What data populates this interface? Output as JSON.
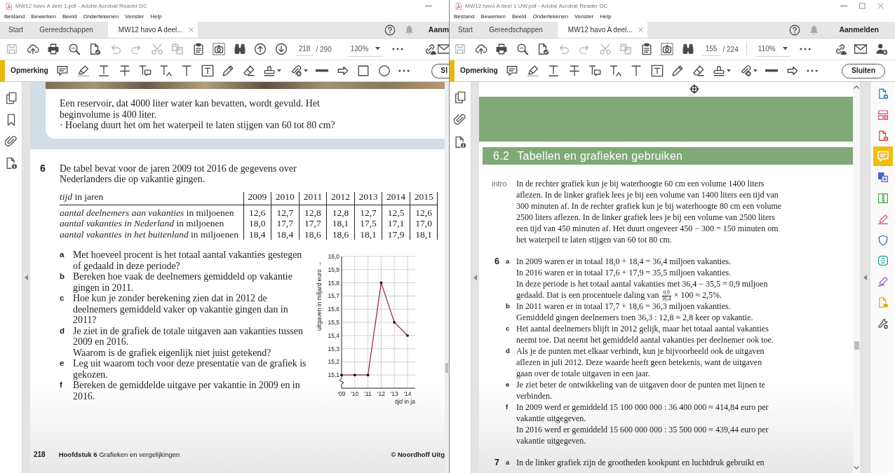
{
  "windows": [
    {
      "title": "MW12 havo A deel 1.pdf - Adobe Acrobat Reader DC",
      "window_buttons": [
        {
          "kind": "minimize"
        }
      ],
      "menu": [
        "Bestand",
        "Bewerken",
        "Beeld",
        "Ondertekenen",
        "Venster",
        "Help"
      ],
      "tabs": [
        {
          "label": "Start",
          "selected": false,
          "closable": false
        },
        {
          "label": "Gereedschappen",
          "selected": false,
          "closable": false
        },
        {
          "label": "MW12 havo A deel...",
          "selected": true,
          "closable": true
        }
      ],
      "account": "Aanm",
      "toolbar": {
        "tools": [
          {
            "kind": "save",
            "disabled": true
          },
          {
            "kind": "upload",
            "disabled": false
          },
          {
            "kind": "print",
            "disabled": false
          },
          {
            "kind": "zoom-search",
            "disabled": false
          },
          {
            "kind": "file-check",
            "disabled": false
          },
          {
            "kind": "undo",
            "disabled": true
          },
          {
            "kind": "redo",
            "disabled": true
          },
          {
            "kind": "cut",
            "disabled": true
          },
          {
            "kind": "copy",
            "disabled": true
          },
          {
            "kind": "clipboard",
            "disabled": false
          },
          {
            "kind": "snapshot",
            "disabled": false
          },
          {
            "kind": "find",
            "disabled": false
          },
          {
            "kind": "previous-page",
            "disabled": false
          },
          {
            "kind": "next-page",
            "disabled": false
          }
        ],
        "page": "218",
        "page_total": "/ 290",
        "zoom": "130%",
        "tools_end": [
          {
            "kind": "more"
          },
          {
            "kind": "share-link"
          },
          {
            "kind": "mail"
          }
        ]
      },
      "comment_bar": {
        "title": "Opmerking",
        "tools": [
          {
            "kind": "sticky-note"
          },
          {
            "kind": "highlight"
          },
          {
            "kind": "underline"
          },
          {
            "kind": "strikethrough"
          },
          {
            "kind": "replace-text"
          },
          {
            "kind": "insert-text"
          },
          {
            "kind": "add-text"
          },
          {
            "kind": "text-box"
          },
          {
            "kind": "pencil"
          },
          {
            "kind": "eraser"
          },
          {
            "kind": "stamp"
          },
          {
            "kind": "attach"
          },
          {
            "kind": "line"
          },
          {
            "kind": "arrow"
          },
          {
            "kind": "rectangle"
          },
          {
            "kind": "oval"
          },
          {
            "kind": "more"
          }
        ],
        "close_button": "Sl"
      },
      "sidebar": [
        {
          "kind": "pages"
        },
        {
          "kind": "bookmarks"
        },
        {
          "kind": "attachments"
        },
        {
          "kind": "properties"
        }
      ],
      "document": {
        "blocks": [
          {
            "kind": "exercise-box",
            "photo": true,
            "paragraphs": [
              [
                "Een reservoir, dat 4000 liter water kan bevatten, wordt gevuld. Het",
                "beginvolume is 400 liter."
              ],
              [
                "· Hoelang duurt het om het waterpeil te laten stijgen van 60 tot 80 cm?"
              ]
            ]
          },
          {
            "kind": "question",
            "number": "6",
            "lines": [
              "De tabel bevat voor de jaren 2009 tot 2016 de gegevens over",
              "Nederlanders die op vakantie gingen."
            ]
          },
          {
            "kind": "table",
            "columns": [
              "*tijd* in jaren",
              "2009",
              "2010",
              "2011",
              "2012",
              "2013",
              "2014",
              "2015"
            ],
            "rows": [
              [
                "*aantal deelnemers aan vakanties* in miljoenen",
                "12,6",
                "12,7",
                "12,8",
                "12,8",
                "12,7",
                "12,5",
                "12,6"
              ],
              [
                "*aantal vakanties in Nederland* in miljoenen",
                "18,0",
                "17,7",
                "17,7",
                "18,1",
                "17,5",
                "17,1",
                "17,0"
              ],
              [
                "*aantal vakanties in het buitenland* in miljoenen",
                "18,4",
                "18,4",
                "18,6",
                "18,6",
                "18,1",
                "17,9",
                "18,1"
              ]
            ]
          },
          {
            "kind": "questions-with-chart",
            "questions": [
              {
                "letter": "a",
                "lines": [
                  "Met hoeveel procent is het totaal aantal vakanties gestegen",
                  "of gedaald in deze periode?"
                ]
              },
              {
                "letter": "b",
                "lines": [
                  "Bereken hoe vaak de deelnemers gemiddeld op vakantie",
                  "gingen in 2011."
                ]
              },
              {
                "letter": "c",
                "lines": [
                  "Hoe kun je zonder berekening zien dat in 2012 de",
                  "deelnemers gemiddeld vaker op vakantie gingen dan in",
                  "2011?"
                ]
              },
              {
                "letter": "d",
                "lines": [
                  "Je ziet in de grafiek de totale uitgaven aan vakanties tussen",
                  "2009 en 2016.",
                  "Waarom is de grafiek eigenlijk niet juist getekend?"
                ]
              },
              {
                "letter": "e",
                "lines": [
                  "Leg uit waarom toch voor deze presentatie van de grafiek is",
                  "gekozen."
                ]
              },
              {
                "letter": "f",
                "lines": [
                  "Bereken de gemiddelde uitgave per vakantie in 2009 en in",
                  "2016."
                ]
              }
            ],
            "chart_data": {
              "type": "line",
              "grid": true,
              "xlabel": "*tijd* in ja",
              "ylabel": "uitgaven in miljard euro →",
              "categories": [
                "'09",
                "'10",
                "'11",
                "'12",
                "'13",
                "'14"
              ],
              "values": [
                15.1,
                15.1,
                15.1,
                15.8,
                15.5,
                15.4
              ],
              "ylim": [
                15.0,
                16.0
              ],
              "yticks": [
                {
                  "value": 15.1,
                  "label": "15,1"
                },
                {
                  "value": 15.2,
                  "label": "15,2"
                },
                {
                  "value": 15.3,
                  "label": "15,3"
                },
                {
                  "value": 15.4,
                  "label": "15,4"
                },
                {
                  "value": 15.5,
                  "label": "15,5"
                },
                {
                  "value": 15.6,
                  "label": "15,6"
                },
                {
                  "value": 15.7,
                  "label": "15,7"
                },
                {
                  "value": 15.8,
                  "label": "15,8"
                },
                {
                  "value": 15.9,
                  "label": "15,9"
                },
                {
                  "value": 16.0,
                  "label": "16,0"
                }
              ]
            }
          },
          {
            "kind": "footer",
            "page_number": "218",
            "chapter": "**Hoofdstuk 6** Grafieken en vergelijkingen",
            "publisher": "© Noordhoff Uitg"
          }
        ]
      }
    },
    {
      "title": "MW12 havo A deel 1 UW.pdf - Adobe Acrobat Reader DC",
      "window_buttons": [
        {
          "kind": "minimize"
        },
        {
          "kind": "maximize"
        },
        {
          "kind": "close"
        }
      ],
      "menu": [
        "Bestand",
        "Bewerken",
        "Beeld",
        "Ondertekenen",
        "Venster",
        "Help"
      ],
      "tabs": [
        {
          "label": "Start",
          "selected": false,
          "closable": false
        },
        {
          "label": "Gereedschappen",
          "selected": false,
          "closable": false
        },
        {
          "label": "MW12 havo A deel...",
          "selected": true,
          "closable": true
        }
      ],
      "account": "Aanmelden",
      "toolbar": {
        "tools": [
          {
            "kind": "save",
            "disabled": true
          },
          {
            "kind": "upload",
            "disabled": false
          },
          {
            "kind": "print",
            "disabled": false
          },
          {
            "kind": "zoom-search",
            "disabled": false
          },
          {
            "kind": "file-check",
            "disabled": false
          },
          {
            "kind": "undo",
            "disabled": true
          },
          {
            "kind": "redo",
            "disabled": true
          },
          {
            "kind": "cut",
            "disabled": true
          },
          {
            "kind": "copy",
            "disabled": true
          },
          {
            "kind": "clipboard",
            "disabled": false
          },
          {
            "kind": "snapshot",
            "disabled": false
          },
          {
            "kind": "find",
            "disabled": false
          }
        ],
        "page": "155",
        "page_total": "/ 224",
        "zoom": "110%",
        "tools_end": [
          {
            "kind": "more"
          },
          {
            "kind": "share-link"
          },
          {
            "kind": "mail"
          },
          {
            "kind": "add-user"
          }
        ]
      },
      "comment_bar": {
        "title": "Opmerking",
        "tools": [
          {
            "kind": "sticky-note"
          },
          {
            "kind": "highlight"
          },
          {
            "kind": "underline"
          },
          {
            "kind": "strikethrough"
          },
          {
            "kind": "replace-text"
          },
          {
            "kind": "insert-text"
          },
          {
            "kind": "add-text"
          },
          {
            "kind": "text-box"
          },
          {
            "kind": "pencil"
          },
          {
            "kind": "eraser"
          },
          {
            "kind": "stamp"
          },
          {
            "kind": "attach"
          },
          {
            "kind": "line"
          },
          {
            "kind": "arrow"
          },
          {
            "kind": "more"
          }
        ],
        "close_button": "Sluiten"
      },
      "sidebar": [
        {
          "kind": "pages"
        },
        {
          "kind": "attachments"
        },
        {
          "kind": "properties"
        }
      ],
      "cursor": {
        "kind": "crosshair"
      },
      "document": {
        "blocks": [
          {
            "kind": "banner"
          },
          {
            "kind": "section-heading",
            "number": "6.2",
            "title": "Tabellen en grafieken gebruiken"
          },
          {
            "kind": "intro",
            "label": "intro",
            "lines": [
              "In de rechter grafiek kun je bij waterhoogte 60 cm een volume 1400 liters",
              "aflezen. In de linker grafiek lees je bij een volume van 1400 liters een tijd van",
              "300 minuten af. In de rechter grafiek kun je bij waterhoogte 80 cm een volume",
              "2500 liters aflezen. In de linker grafiek lees je bij een volume van 2500 liters",
              "een tijd van 450 minuten af. Het duurt ongeveer 450 − 300 = 150 minuten om",
              "het waterpeil te laten stijgen van 60 tot 80 cm."
            ]
          },
          {
            "kind": "answers",
            "items": [
              {
                "number": "6",
                "parts": [
                  {
                    "letter": "a",
                    "lines": [
                      "In 2009 waren er in totaal 18,0 + 18,4 = 36,4 miljoen vakanties.",
                      "In 2016 waren er in totaal 17,6 + 17,9 = 35,5 miljoen vakanties.",
                      "In deze periode is het totaal aantal vakanties met 36,4 − 35,5 = 0,9 miljoen",
                      [
                        "gedaald. Dat is een procentuele daling van ",
                        {
                          "numerator": "0,9",
                          "denominator": "36,4"
                        },
                        " × 100 ≈ 2,5%."
                      ]
                    ]
                  },
                  {
                    "letter": "b",
                    "lines": [
                      "In 2011 waren er in totaal 17,7 + 18,6 = 36,3 miljoen vakanties.",
                      "Gemiddeld gingen deelnemers toen 36,3 : 12,8 ≈ 2,8 keer op vakantie."
                    ]
                  },
                  {
                    "letter": "c",
                    "lines": [
                      "Het aantal deelnemers blijft in 2012 gelijk, maar het totaal aantal vakanties",
                      "neemt toe. Dat neemt het gemiddeld aantal vakanties per deelnemer ook toe."
                    ]
                  },
                  {
                    "letter": "d",
                    "lines": [
                      "Als je de punten met elkaar verbindt, kun je bijvoorbeeld ook de uitgaven",
                      "aflezen in juli 2012. Deze waarde heeft geen betekenis, want de uitgaven",
                      "gaan over de totale uitgaven in een jaar."
                    ]
                  },
                  {
                    "letter": "e",
                    "lines": [
                      "Je ziet beter de ontwikkeling van de uitgaven door de punten met lijnen te",
                      "verbinden."
                    ]
                  },
                  {
                    "letter": "f",
                    "lines": [
                      "In 2009 werd er gemiddeld 15 100 000 000 : 36 400 000 ≈ 414,84 euro per",
                      "vakantie uitgegeven.",
                      "In 2016 werd er gemiddeld 15 600 000 000 : 35 500 000 ≈ 439,44 euro per",
                      "vakantie uitgegeven."
                    ]
                  }
                ]
              },
              {
                "number": "7",
                "parts": [
                  {
                    "letter": "a",
                    "lines": [
                      "In de linker grafiek zijn de grootheden kookpunt en luchtdruk gebruikt en"
                    ]
                  }
                ]
              }
            ]
          }
        ]
      },
      "tools_panel": [
        {
          "kind": "create-pdf",
          "selected": false
        },
        {
          "kind": "organize-pages",
          "selected": false
        },
        {
          "kind": "export-pdf",
          "selected": false
        },
        {
          "kind": "comment",
          "selected": true
        },
        {
          "kind": "combine-files",
          "selected": false
        },
        {
          "kind": "edit-pdf",
          "selected": false
        },
        {
          "kind": "fill-sign",
          "selected": false
        },
        {
          "kind": "protect",
          "selected": false
        },
        {
          "kind": "scan",
          "selected": false
        },
        {
          "kind": "sign",
          "selected": false
        },
        {
          "kind": "send",
          "selected": false
        },
        {
          "kind": "more-tools",
          "selected": false
        }
      ]
    }
  ]
}
